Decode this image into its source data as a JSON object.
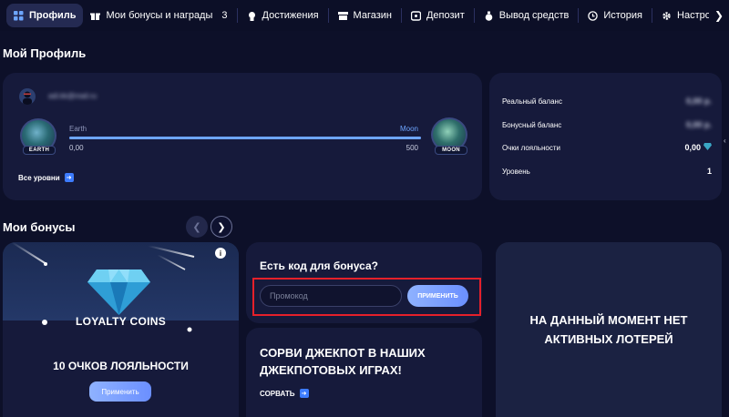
{
  "nav": {
    "items": [
      {
        "label": "Профиль",
        "icon": "grid-icon",
        "active": true
      },
      {
        "label": "Мои бонусы и награды",
        "icon": "gift-icon",
        "count": "3"
      },
      {
        "label": "Достижения",
        "icon": "medal-icon"
      },
      {
        "label": "Магазин",
        "icon": "store-icon"
      },
      {
        "label": "Депозит",
        "icon": "deposit-icon"
      },
      {
        "label": "Вывод средств",
        "icon": "money-bag-icon"
      },
      {
        "label": "История",
        "icon": "clock-icon"
      },
      {
        "label": "Настройки ак",
        "icon": "gear-icon"
      }
    ]
  },
  "profile": {
    "section_title": "Мой Профиль",
    "email": "adi.kk@mail.ru",
    "level_from": "Earth",
    "level_to": "Moon",
    "badge_from": "EARTH",
    "badge_to": "MOON",
    "points_from": "0,00",
    "points_to": "500",
    "progress_fraction": 1.0,
    "all_levels": "Все уровни"
  },
  "balance": {
    "rows": [
      {
        "label": "Реальный баланс",
        "value": "0,00 р.",
        "blurred": true
      },
      {
        "label": "Бонусный баланс",
        "value": "0,00 р.",
        "blurred": true
      },
      {
        "label": "Очки лояльности",
        "value": "0,00",
        "blurred": false
      },
      {
        "label": "Уровень",
        "value": "1",
        "blurred": false
      }
    ]
  },
  "bonuses": {
    "section_title": "Мои бонусы",
    "loyalty": {
      "image_title": "LOYALTY COINS",
      "points": "10 ОЧКОВ ЛОЯЛЬНОСТИ",
      "apply": "Применить",
      "info": "i"
    },
    "promo": {
      "title": "Есть код для бонуса?",
      "placeholder": "Промокод",
      "apply": "ПРИМЕНИТЬ"
    },
    "jackpot": {
      "title": "СОРВИ ДЖЕКПОТ В НАШИХ ДЖЕКПОТОВЫХ ИГРАХ!",
      "link": "СОРВАТЬ"
    },
    "lottery": {
      "text": "НА ДАННЫЙ МОМЕНТ НЕТ АКТИВНЫХ ЛОТЕРЕЙ"
    }
  },
  "colors": {
    "background": "#0d1029",
    "card": "#161a3b",
    "accent": "#6da5ff",
    "highlight_frame": "#e5202a"
  }
}
